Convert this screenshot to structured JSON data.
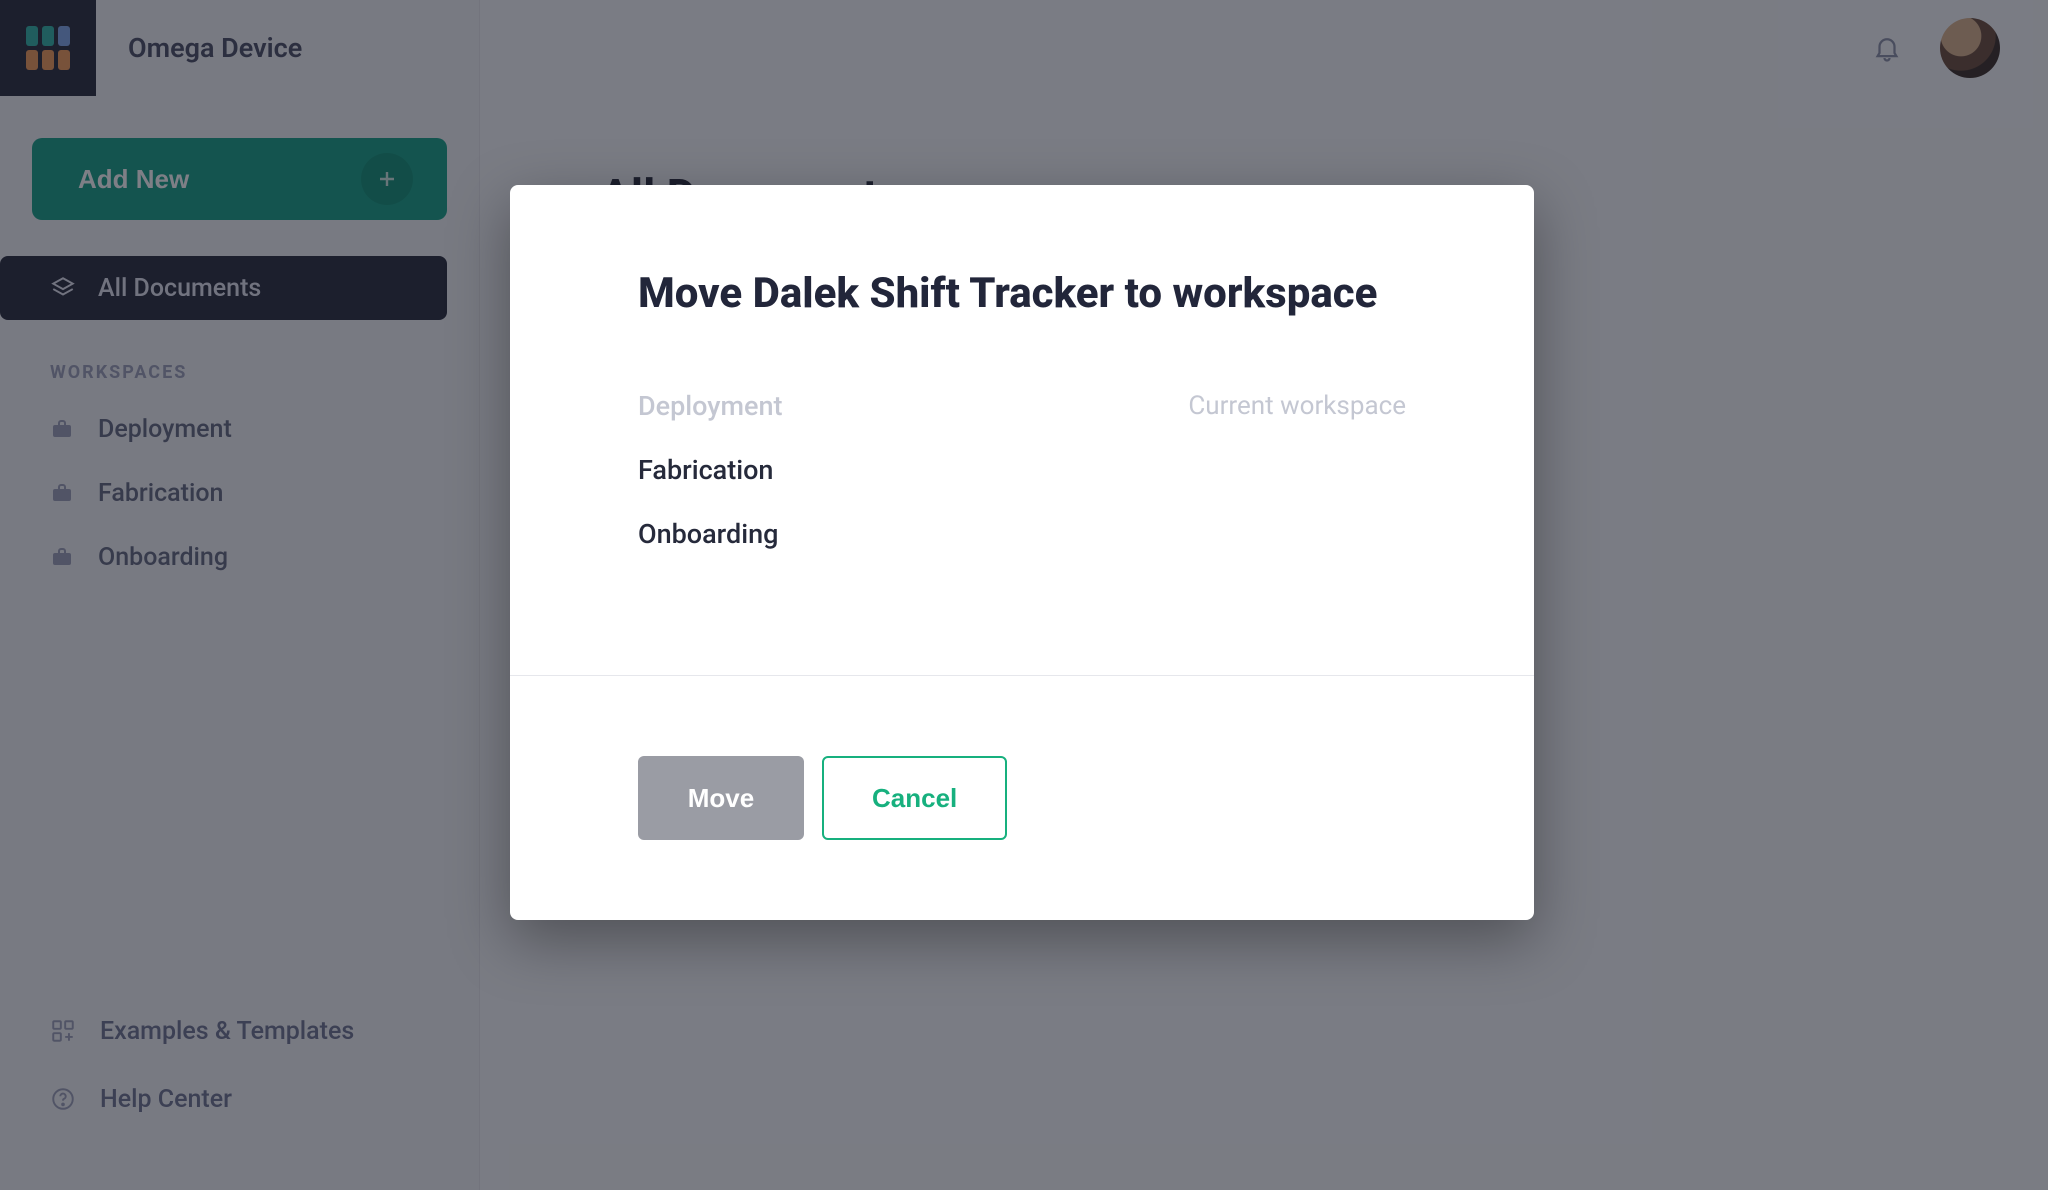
{
  "brand": {
    "title": "Omega Device"
  },
  "sidebar": {
    "add_new_label": "Add New",
    "all_documents_label": "All Documents",
    "section_label": "WORKSPACES",
    "workspaces": [
      {
        "label": "Deployment"
      },
      {
        "label": "Fabrication"
      },
      {
        "label": "Onboarding"
      }
    ],
    "footer": {
      "examples_label": "Examples & Templates",
      "help_label": "Help Center"
    }
  },
  "main": {
    "page_title": "All Documents"
  },
  "modal": {
    "title": "Move Dalek Shift Tracker to workspace",
    "current_hint": "Current workspace",
    "workspaces": [
      {
        "label": "Deployment",
        "current": true
      },
      {
        "label": "Fabrication",
        "current": false
      },
      {
        "label": "Onboarding",
        "current": false
      }
    ],
    "move_label": "Move",
    "cancel_label": "Cancel"
  }
}
